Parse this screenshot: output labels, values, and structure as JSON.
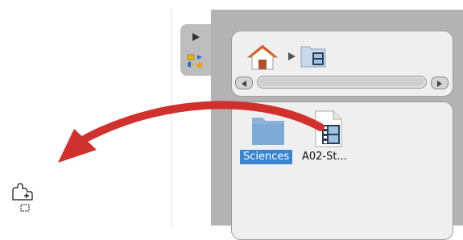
{
  "nav": {
    "home_icon": "home-icon",
    "separator_icon": "triangle-right-icon",
    "current_folder_icon": "film-folder-icon"
  },
  "scrollbar": {
    "left_icon": "scroll-left-arrow-icon",
    "right_icon": "scroll-right-arrow-icon"
  },
  "files": [
    {
      "label": "Sciences",
      "icon": "folder-icon",
      "selected": true
    },
    {
      "label": "A02-St...",
      "icon": "video-file-icon",
      "selected": false
    }
  ],
  "annotation": {
    "icon": "red-curved-arrow-icon",
    "color": "#d0312d"
  },
  "cursor": {
    "icon": "drag-copy-cursor-icon"
  },
  "colors": {
    "panel_bg": "#b3b3b3",
    "box_bg": "#efefef",
    "selection": "#3a84d1",
    "folder": "#8bb3da",
    "arrow": "#d0312d"
  }
}
